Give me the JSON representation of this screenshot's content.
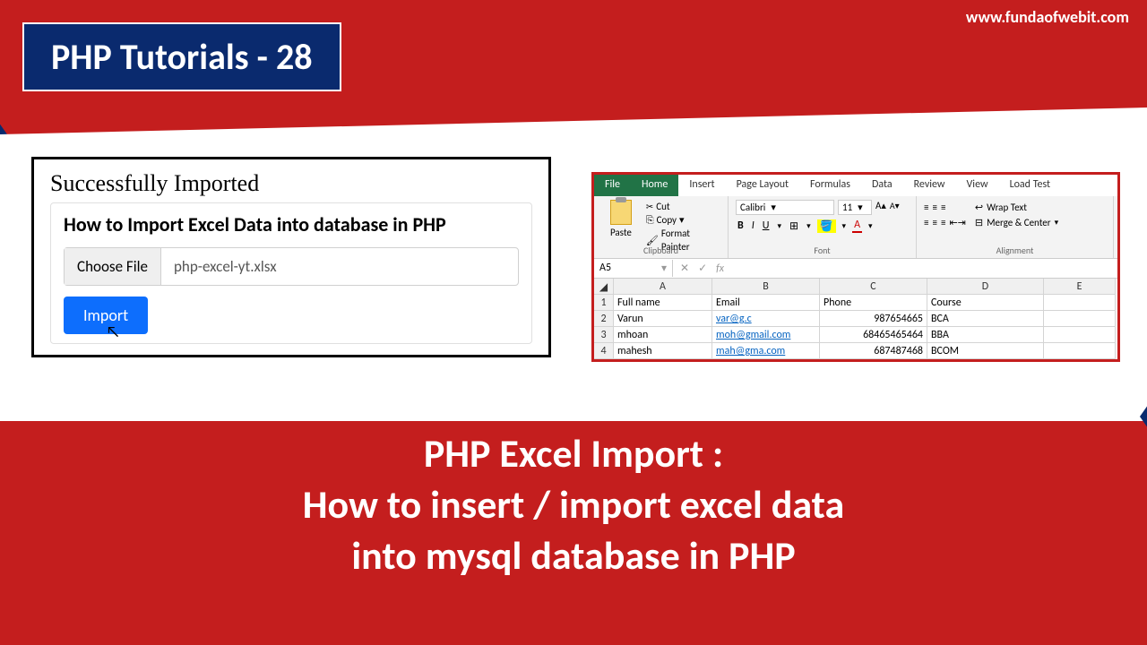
{
  "site_url": "www.fundaofwebit.com",
  "title": "PHP Tutorials - 28",
  "php_panel": {
    "success_msg": "Successfully Imported",
    "heading": "How to Import Excel Data into database in PHP",
    "choose_label": "Choose File",
    "filename": "php-excel-yt.xlsx",
    "import_label": "Import"
  },
  "excel": {
    "tabs": [
      "File",
      "Home",
      "Insert",
      "Page Layout",
      "Formulas",
      "Data",
      "Review",
      "View",
      "Load Test"
    ],
    "active_tab": "Home",
    "clipboard": {
      "cut": "Cut",
      "copy": "Copy",
      "painter": "Format Painter",
      "paste": "Paste",
      "group": "Clipboard"
    },
    "font": {
      "name": "Calibri",
      "size": "11",
      "group": "Font"
    },
    "alignment": {
      "wrap": "Wrap Text",
      "merge": "Merge & Center",
      "group": "Alignment"
    },
    "cell_ref": "A5",
    "columns": [
      "A",
      "B",
      "C",
      "D",
      "E"
    ],
    "headers": [
      "Full name",
      "Email",
      "Phone",
      "Course"
    ],
    "rows": [
      {
        "n": "1",
        "a": "Full name",
        "b": "Email",
        "c": "Phone",
        "d": "Course",
        "e": ""
      },
      {
        "n": "2",
        "a": "Varun",
        "b": "var@g.c",
        "c": "987654665",
        "d": "BCA",
        "e": ""
      },
      {
        "n": "3",
        "a": "mhoan",
        "b": "moh@gmail.com",
        "c": "68465465464",
        "d": "BBA",
        "e": ""
      },
      {
        "n": "4",
        "a": "mahesh",
        "b": "mah@gma.com",
        "c": "687487468",
        "d": "BCOM",
        "e": ""
      }
    ]
  },
  "bottom": {
    "line1": "PHP Excel Import :",
    "line2": "How to insert / import excel data",
    "line3": "into mysql database in PHP"
  }
}
